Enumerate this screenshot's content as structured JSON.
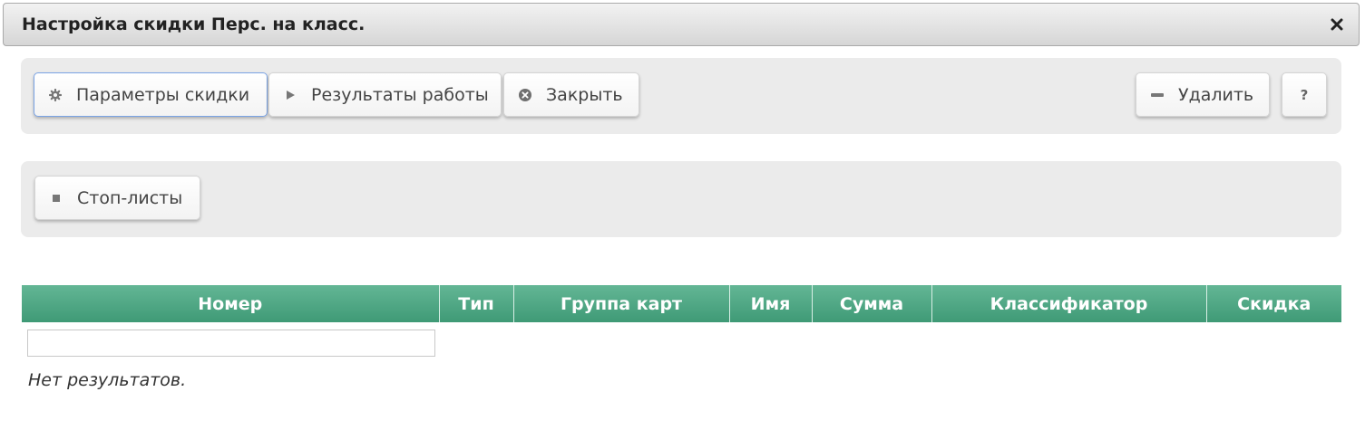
{
  "dialog": {
    "title": "Настройка скидки Перс. на класс.",
    "close_icon": "close-icon"
  },
  "toolbar": {
    "params_label": "Параметры скидки",
    "results_label": "Результаты работы",
    "close_label": "Закрыть",
    "delete_label": "Удалить",
    "help_label": "?"
  },
  "toolbar2": {
    "stoplists_label": "Стоп-листы"
  },
  "table": {
    "columns": [
      "Номер",
      "Тип",
      "Группа карт",
      "Имя",
      "Сумма",
      "Классификатор",
      "Скидка"
    ],
    "filter_value": "",
    "empty_message": "Нет результатов."
  },
  "colors": {
    "header_green": "#4fa984",
    "focus_blue": "#7aa3e5",
    "toolbar_bg": "#ebebeb"
  }
}
